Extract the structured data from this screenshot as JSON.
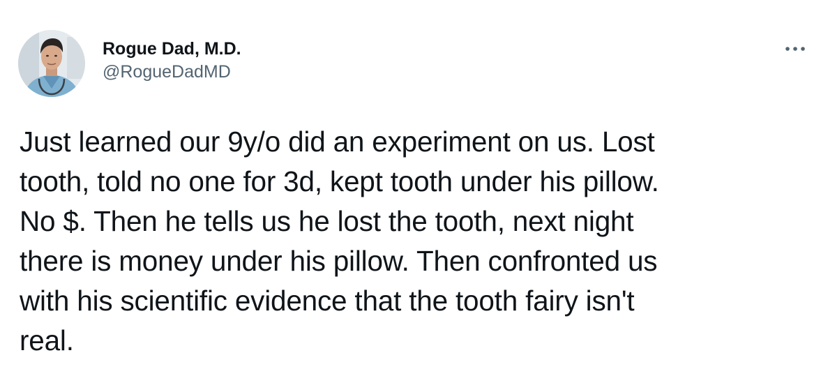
{
  "tweet": {
    "author": {
      "display_name": "Rogue Dad, M.D.",
      "handle": "@RogueDadMD",
      "avatar_icon": "profile-photo"
    },
    "more_icon": "ellipsis-icon",
    "text": "Just learned our 9y/o did an experiment on us.  Lost\ntooth, told no one for 3d, kept tooth under his pillow.\nNo $.  Then he tells us he lost the tooth, next night\nthere is money under his pillow.  Then confronted us\nwith his scientific evidence that the tooth fairy isn't\nreal."
  },
  "colors": {
    "text_primary": "#0f1419",
    "text_secondary": "#536471",
    "background": "#ffffff"
  }
}
